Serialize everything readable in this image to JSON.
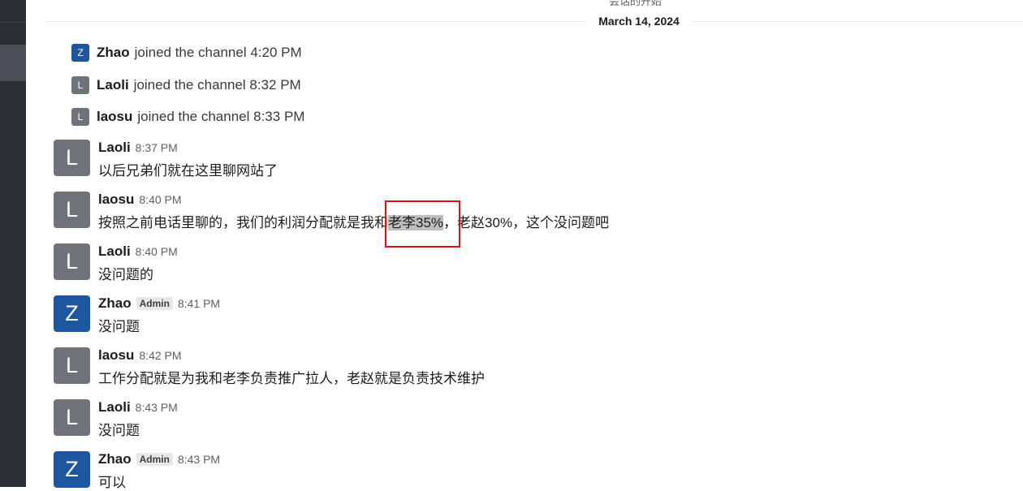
{
  "header": {
    "top_cut_text": "会话的开始",
    "date_divider": "March 14, 2024"
  },
  "joins": [
    {
      "initial": "Z",
      "name": "Zhao",
      "text": "joined the channel 4:20 PM",
      "color": "#1e57a0"
    },
    {
      "initial": "L",
      "name": "Laoli",
      "text": "joined the channel 8:32 PM",
      "color": "#6e7379"
    },
    {
      "initial": "L",
      "name": "laosu",
      "text": "joined the channel 8:33 PM",
      "color": "#6e7379"
    }
  ],
  "messages": [
    {
      "initial": "L",
      "author": "Laoli",
      "badge": "",
      "time": "8:37 PM",
      "text": "以后兄弟们就在这里聊网站了"
    },
    {
      "initial": "L",
      "author": "laosu",
      "badge": "",
      "time": "8:40 PM",
      "text_pre": "按照之前电话里聊的，我们的利润分配就是我和",
      "text_highlight": "老李35%",
      "text_post": "，老赵30%，这个没问题吧"
    },
    {
      "initial": "L",
      "author": "Laoli",
      "badge": "",
      "time": "8:40 PM",
      "text": "没问题的"
    },
    {
      "initial": "Z",
      "author": "Zhao",
      "badge": "Admin",
      "time": "8:41 PM",
      "text": "没问题"
    },
    {
      "initial": "L",
      "author": "laosu",
      "badge": "",
      "time": "8:42 PM",
      "text": "工作分配就是为我和老李负责推广拉人，老赵就是负责技术维护"
    },
    {
      "initial": "L",
      "author": "Laoli",
      "badge": "",
      "time": "8:43 PM",
      "text": "没问题"
    },
    {
      "initial": "Z",
      "author": "Zhao",
      "badge": "Admin",
      "time": "8:43 PM",
      "text": "可以"
    }
  ],
  "colors": {
    "avatar_zhao": "#1e57a0",
    "avatar_gray": "#6e7379",
    "annotation_box": "#e0101a"
  }
}
